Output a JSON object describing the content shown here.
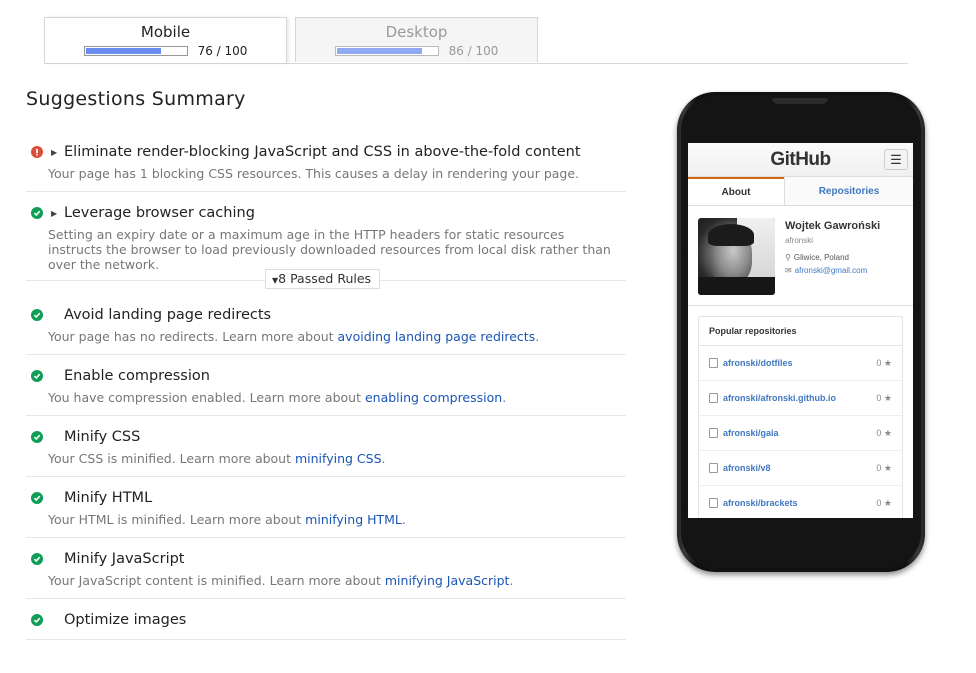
{
  "tabs": [
    {
      "label": "Mobile",
      "score": 76,
      "score_text": "76 / 100",
      "active": true
    },
    {
      "label": "Desktop",
      "score": 86,
      "score_text": "86 / 100",
      "active": false
    }
  ],
  "summary": {
    "title": "Suggestions Summary",
    "rules": [
      {
        "status": "error",
        "title": "Eliminate render-blocking JavaScript and CSS in above-the-fold content",
        "desc": "Your page has 1 blocking CSS resources. This causes a delay in rendering your page."
      },
      {
        "status": "pass",
        "title": "Leverage browser caching",
        "desc": "Setting an expiry date or a maximum age in the HTTP headers for static resources instructs the browser to load previously downloaded resources from local disk rather than over the network."
      }
    ],
    "passed_toggle": "8 Passed Rules",
    "passed_rules": [
      {
        "title": "Avoid landing page redirects",
        "desc": "Your page has no redirects. Learn more about ",
        "link": "avoiding landing page redirects"
      },
      {
        "title": "Enable compression",
        "desc": "You have compression enabled. Learn more about ",
        "link": "enabling compression"
      },
      {
        "title": "Minify CSS",
        "desc": "Your CSS is minified. Learn more about ",
        "link": "minifying CSS"
      },
      {
        "title": "Minify HTML",
        "desc": "Your HTML is minified. Learn more about ",
        "link": "minifying HTML"
      },
      {
        "title": "Minify JavaScript",
        "desc": "Your JavaScript content is minified. Learn more about ",
        "link": "minifying JavaScript"
      },
      {
        "title": "Optimize images",
        "desc": "",
        "link": ""
      }
    ]
  },
  "colors": {
    "error": "#dd4b39",
    "pass": "#0f9d58",
    "link": "#1a55b5",
    "score_bar": "#6b8cf0"
  },
  "phone_preview": {
    "logo": "GitHub",
    "menu_icon": "☰",
    "tabs": {
      "about": "About",
      "repositories": "Repositories"
    },
    "profile": {
      "name": "Wojtek Gawroński",
      "username": "afronski",
      "location": "Gliwice, Poland",
      "email": "afronski@gmail.com"
    },
    "repos_title": "Popular repositories",
    "repos": [
      {
        "name": "afronski/dotfiles",
        "stars": "0"
      },
      {
        "name": "afronski/afronski.github.io",
        "stars": "0"
      },
      {
        "name": "afronski/gaia",
        "stars": "0"
      },
      {
        "name": "afronski/v8",
        "stars": "0"
      },
      {
        "name": "afronski/brackets",
        "stars": "0"
      }
    ]
  }
}
